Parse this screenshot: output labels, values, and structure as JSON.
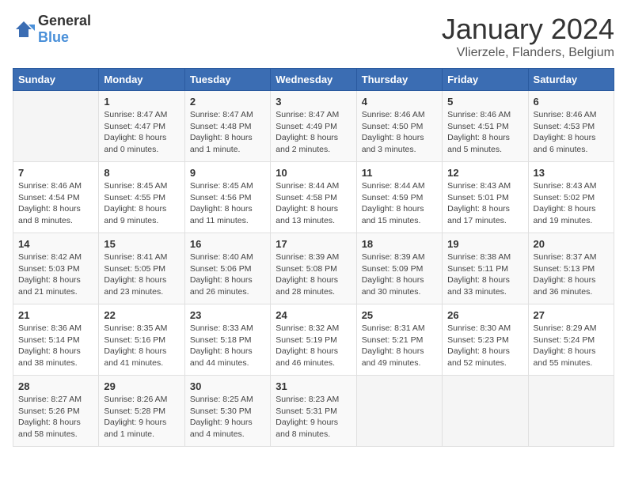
{
  "header": {
    "logo_general": "General",
    "logo_blue": "Blue",
    "month_title": "January 2024",
    "location": "Vlierzele, Flanders, Belgium"
  },
  "days_of_week": [
    "Sunday",
    "Monday",
    "Tuesday",
    "Wednesday",
    "Thursday",
    "Friday",
    "Saturday"
  ],
  "weeks": [
    [
      {
        "day": "",
        "content": ""
      },
      {
        "day": "1",
        "content": "Sunrise: 8:47 AM\nSunset: 4:47 PM\nDaylight: 8 hours\nand 0 minutes."
      },
      {
        "day": "2",
        "content": "Sunrise: 8:47 AM\nSunset: 4:48 PM\nDaylight: 8 hours\nand 1 minute."
      },
      {
        "day": "3",
        "content": "Sunrise: 8:47 AM\nSunset: 4:49 PM\nDaylight: 8 hours\nand 2 minutes."
      },
      {
        "day": "4",
        "content": "Sunrise: 8:46 AM\nSunset: 4:50 PM\nDaylight: 8 hours\nand 3 minutes."
      },
      {
        "day": "5",
        "content": "Sunrise: 8:46 AM\nSunset: 4:51 PM\nDaylight: 8 hours\nand 5 minutes."
      },
      {
        "day": "6",
        "content": "Sunrise: 8:46 AM\nSunset: 4:53 PM\nDaylight: 8 hours\nand 6 minutes."
      }
    ],
    [
      {
        "day": "7",
        "content": "Sunrise: 8:46 AM\nSunset: 4:54 PM\nDaylight: 8 hours\nand 8 minutes."
      },
      {
        "day": "8",
        "content": "Sunrise: 8:45 AM\nSunset: 4:55 PM\nDaylight: 8 hours\nand 9 minutes."
      },
      {
        "day": "9",
        "content": "Sunrise: 8:45 AM\nSunset: 4:56 PM\nDaylight: 8 hours\nand 11 minutes."
      },
      {
        "day": "10",
        "content": "Sunrise: 8:44 AM\nSunset: 4:58 PM\nDaylight: 8 hours\nand 13 minutes."
      },
      {
        "day": "11",
        "content": "Sunrise: 8:44 AM\nSunset: 4:59 PM\nDaylight: 8 hours\nand 15 minutes."
      },
      {
        "day": "12",
        "content": "Sunrise: 8:43 AM\nSunset: 5:01 PM\nDaylight: 8 hours\nand 17 minutes."
      },
      {
        "day": "13",
        "content": "Sunrise: 8:43 AM\nSunset: 5:02 PM\nDaylight: 8 hours\nand 19 minutes."
      }
    ],
    [
      {
        "day": "14",
        "content": "Sunrise: 8:42 AM\nSunset: 5:03 PM\nDaylight: 8 hours\nand 21 minutes."
      },
      {
        "day": "15",
        "content": "Sunrise: 8:41 AM\nSunset: 5:05 PM\nDaylight: 8 hours\nand 23 minutes."
      },
      {
        "day": "16",
        "content": "Sunrise: 8:40 AM\nSunset: 5:06 PM\nDaylight: 8 hours\nand 26 minutes."
      },
      {
        "day": "17",
        "content": "Sunrise: 8:39 AM\nSunset: 5:08 PM\nDaylight: 8 hours\nand 28 minutes."
      },
      {
        "day": "18",
        "content": "Sunrise: 8:39 AM\nSunset: 5:09 PM\nDaylight: 8 hours\nand 30 minutes."
      },
      {
        "day": "19",
        "content": "Sunrise: 8:38 AM\nSunset: 5:11 PM\nDaylight: 8 hours\nand 33 minutes."
      },
      {
        "day": "20",
        "content": "Sunrise: 8:37 AM\nSunset: 5:13 PM\nDaylight: 8 hours\nand 36 minutes."
      }
    ],
    [
      {
        "day": "21",
        "content": "Sunrise: 8:36 AM\nSunset: 5:14 PM\nDaylight: 8 hours\nand 38 minutes."
      },
      {
        "day": "22",
        "content": "Sunrise: 8:35 AM\nSunset: 5:16 PM\nDaylight: 8 hours\nand 41 minutes."
      },
      {
        "day": "23",
        "content": "Sunrise: 8:33 AM\nSunset: 5:18 PM\nDaylight: 8 hours\nand 44 minutes."
      },
      {
        "day": "24",
        "content": "Sunrise: 8:32 AM\nSunset: 5:19 PM\nDaylight: 8 hours\nand 46 minutes."
      },
      {
        "day": "25",
        "content": "Sunrise: 8:31 AM\nSunset: 5:21 PM\nDaylight: 8 hours\nand 49 minutes."
      },
      {
        "day": "26",
        "content": "Sunrise: 8:30 AM\nSunset: 5:23 PM\nDaylight: 8 hours\nand 52 minutes."
      },
      {
        "day": "27",
        "content": "Sunrise: 8:29 AM\nSunset: 5:24 PM\nDaylight: 8 hours\nand 55 minutes."
      }
    ],
    [
      {
        "day": "28",
        "content": "Sunrise: 8:27 AM\nSunset: 5:26 PM\nDaylight: 8 hours\nand 58 minutes."
      },
      {
        "day": "29",
        "content": "Sunrise: 8:26 AM\nSunset: 5:28 PM\nDaylight: 9 hours\nand 1 minute."
      },
      {
        "day": "30",
        "content": "Sunrise: 8:25 AM\nSunset: 5:30 PM\nDaylight: 9 hours\nand 4 minutes."
      },
      {
        "day": "31",
        "content": "Sunrise: 8:23 AM\nSunset: 5:31 PM\nDaylight: 9 hours\nand 8 minutes."
      },
      {
        "day": "",
        "content": ""
      },
      {
        "day": "",
        "content": ""
      },
      {
        "day": "",
        "content": ""
      }
    ]
  ]
}
